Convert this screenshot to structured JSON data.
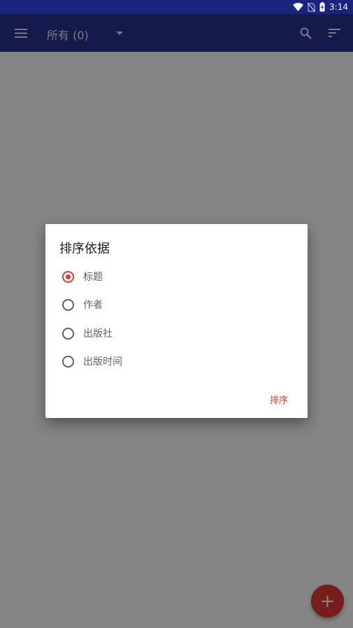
{
  "status_bar": {
    "time": "3:14"
  },
  "app_bar": {
    "title": "所有 (0)"
  },
  "dialog": {
    "title": "排序依据",
    "options": [
      {
        "label": "标题",
        "checked": true
      },
      {
        "label": "作者",
        "checked": false
      },
      {
        "label": "出版社",
        "checked": false
      },
      {
        "label": "出版时间",
        "checked": false
      }
    ],
    "action_label": "排序"
  },
  "fab": {
    "label": "+"
  },
  "colors": {
    "status_bar": "#1a237e",
    "app_bar": "#283593",
    "accent": "#e53935"
  },
  "icons": [
    "wifi-icon",
    "no-sim-icon",
    "battery-charging-icon",
    "menu-icon",
    "dropdown-arrow-icon",
    "search-icon",
    "sort-icon",
    "add-icon"
  ]
}
